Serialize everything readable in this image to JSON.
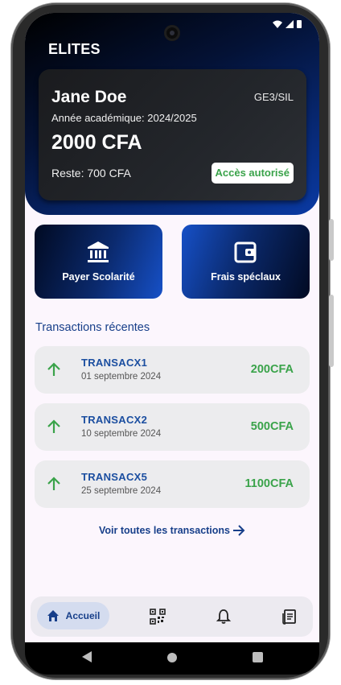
{
  "app": {
    "title": "ELITES"
  },
  "student": {
    "name": "Jane Doe",
    "class": "GE3/SIL",
    "academic_year": "Année académique: 2024/2025",
    "amount": "2000 CFA",
    "remaining": "Reste: 700 CFA",
    "access_status": "Accès autorisé",
    "access_color": "#3aa34a"
  },
  "actions": [
    {
      "label": "Payer Scolarité",
      "icon": "bank-icon"
    },
    {
      "label": "Frais spéclaux",
      "icon": "wallet-icon"
    }
  ],
  "transactions": {
    "title": "Transactions récentes",
    "items": [
      {
        "name": "TRANSACX1",
        "date": "01 septembre 2024",
        "amount": "200CFA"
      },
      {
        "name": "TRANSACX2",
        "date": "10 septembre 2024",
        "amount": "500CFA"
      },
      {
        "name": "TRANSACX5",
        "date": "25 septembre 2024",
        "amount": "1100CFA"
      }
    ],
    "see_all": "Voir toutes les transactions"
  },
  "bottom_nav": {
    "home_label": "Accueil",
    "items": [
      "home-icon",
      "qr-code-icon",
      "bell-icon",
      "receipt-icon"
    ]
  },
  "colors": {
    "primary": "#173f8a",
    "accent_green": "#3aa34a",
    "gradient_dark": "#010a22",
    "gradient_blue": "#1650c7"
  }
}
